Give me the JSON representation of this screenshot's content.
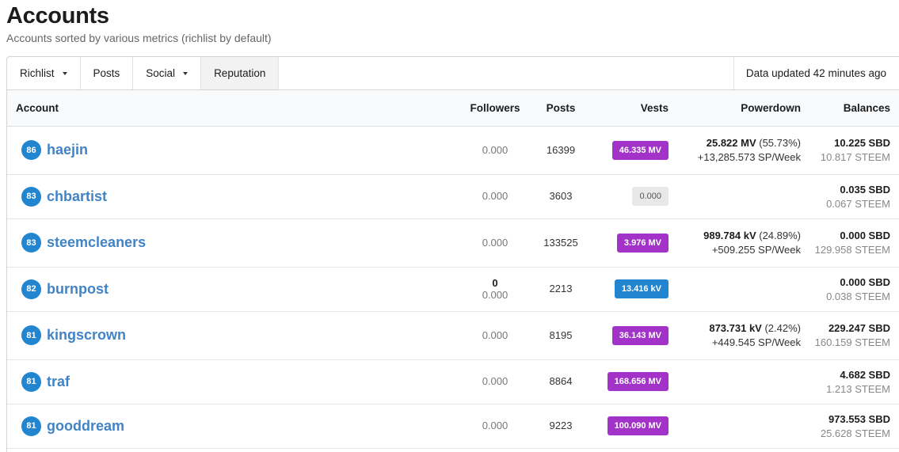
{
  "page": {
    "title": "Accounts",
    "subtitle": "Accounts sorted by various metrics (richlist by default)"
  },
  "menu": {
    "items": [
      {
        "label": "Richlist",
        "dropdown": true,
        "active": false
      },
      {
        "label": "Posts",
        "dropdown": false,
        "active": false
      },
      {
        "label": "Social",
        "dropdown": true,
        "active": false
      },
      {
        "label": "Reputation",
        "dropdown": false,
        "active": true
      }
    ],
    "status": "Data updated 42 minutes ago"
  },
  "table": {
    "headers": {
      "account": "Account",
      "followers": "Followers",
      "posts": "Posts",
      "vests": "Vests",
      "powerdown": "Powerdown",
      "balances": "Balances"
    },
    "colors": {
      "purple": "#a333c8",
      "grey": "#e8e8e8",
      "blue": "#2185d0"
    },
    "rows": [
      {
        "rep": "86",
        "name": "haejin",
        "followers_top": "",
        "followers": "0.000",
        "posts": "16399",
        "vests": "46.335 MV",
        "vest_color": "purple",
        "pd_main": "25.822 MV",
        "pd_pct": " (55.73%)",
        "pd_rate": "+13,285.573 SP/Week",
        "sbd": "10.225 SBD",
        "steem": "10.817 STEEM"
      },
      {
        "rep": "83",
        "name": "chbartist",
        "followers_top": "",
        "followers": "0.000",
        "posts": "3603",
        "vests": "0.000",
        "vest_color": "grey",
        "pd_main": "",
        "pd_pct": "",
        "pd_rate": "",
        "sbd": "0.035 SBD",
        "steem": "0.067 STEEM"
      },
      {
        "rep": "83",
        "name": "steemcleaners",
        "followers_top": "",
        "followers": "0.000",
        "posts": "133525",
        "vests": "3.976 MV",
        "vest_color": "purple",
        "pd_main": "989.784 kV",
        "pd_pct": " (24.89%)",
        "pd_rate": "+509.255 SP/Week",
        "sbd": "0.000 SBD",
        "steem": "129.958 STEEM"
      },
      {
        "rep": "82",
        "name": "burnpost",
        "followers_top": "0",
        "followers": "0.000",
        "posts": "2213",
        "vests": "13.416 kV",
        "vest_color": "blue",
        "pd_main": "",
        "pd_pct": "",
        "pd_rate": "",
        "sbd": "0.000 SBD",
        "steem": "0.038 STEEM"
      },
      {
        "rep": "81",
        "name": "kingscrown",
        "followers_top": "",
        "followers": "0.000",
        "posts": "8195",
        "vests": "36.143 MV",
        "vest_color": "purple",
        "pd_main": "873.731 kV",
        "pd_pct": " (2.42%)",
        "pd_rate": "+449.545 SP/Week",
        "sbd": "229.247 SBD",
        "steem": "160.159 STEEM"
      },
      {
        "rep": "81",
        "name": "traf",
        "followers_top": "",
        "followers": "0.000",
        "posts": "8864",
        "vests": "168.656 MV",
        "vest_color": "purple",
        "pd_main": "",
        "pd_pct": "",
        "pd_rate": "",
        "sbd": "4.682 SBD",
        "steem": "1.213 STEEM"
      },
      {
        "rep": "81",
        "name": "gooddream",
        "followers_top": "",
        "followers": "0.000",
        "posts": "9223",
        "vests": "100.090 MV",
        "vest_color": "purple",
        "pd_main": "",
        "pd_pct": "",
        "pd_rate": "",
        "sbd": "973.553 SBD",
        "steem": "25.628 STEEM"
      }
    ]
  }
}
